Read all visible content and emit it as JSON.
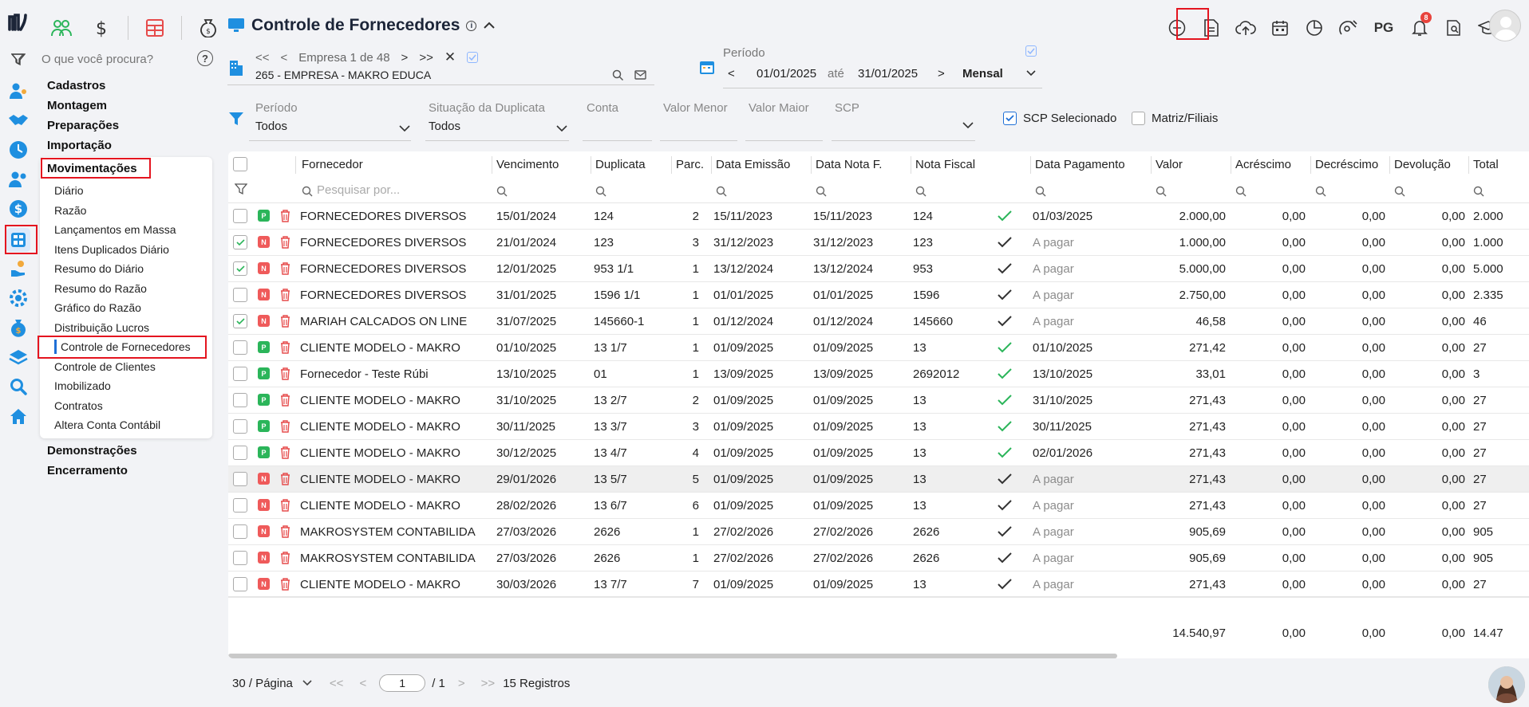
{
  "search": {
    "placeholder": "O que você procura?"
  },
  "menu": {
    "groups_top": [
      "Cadastros",
      "Montagem",
      "Preparações",
      "Importação",
      "Movimentações"
    ],
    "groups_bottom": [
      "Demonstrações",
      "Encerramento"
    ],
    "submenu": [
      "Diário",
      "Razão",
      "Lançamentos em Massa",
      "Itens Duplicados Diário",
      "Resumo do Diário",
      "Resumo do Razão",
      "Gráfico do Razão",
      "Distribuição Lucros",
      "Controle de Fornecedores",
      "Controle de Clientes",
      "Imobilizado",
      "Contratos",
      "Altera Conta Contábil"
    ],
    "active": "Controle de Fornecedores"
  },
  "header": {
    "title": "Controle de Fornecedores",
    "toolbar_text": "PG",
    "notifications_count": "8"
  },
  "empresa": {
    "nav_text": "Empresa 1 de 48",
    "name": "265 - EMPRESA - MAKRO EDUCA"
  },
  "periodo": {
    "label": "Período",
    "start": "01/01/2025",
    "sep": "até",
    "end": "31/01/2025",
    "mode": "Mensal"
  },
  "filters": {
    "periodo": {
      "label": "Período",
      "value": "Todos"
    },
    "situacao": {
      "label": "Situação da Duplicata",
      "value": "Todos"
    },
    "conta": {
      "label": "Conta",
      "value": ""
    },
    "valor_menor": {
      "label": "Valor Menor",
      "value": ""
    },
    "valor_maior": {
      "label": "Valor Maior",
      "value": ""
    },
    "scp": {
      "label": "SCP",
      "value": ""
    },
    "scp_selecionado": "SCP Selecionado",
    "matriz_filiais": "Matriz/Filiais"
  },
  "table": {
    "columns": [
      "Fornecedor",
      "Vencimento",
      "Duplicata",
      "Parc.",
      "Data Emissão",
      "Data Nota F.",
      "Nota Fiscal",
      "Data Pagamento",
      "Valor",
      "Acréscimo",
      "Decréscimo",
      "Devolução",
      "Total"
    ],
    "search_placeholder": "Pesquisar por...",
    "rows": [
      {
        "checked": false,
        "tag": "P",
        "fornecedor": "FORNECEDORES DIVERSOS",
        "vencimento": "15/01/2024",
        "duplicata": "124",
        "parc": "2",
        "emissao": "15/11/2023",
        "data_nf": "15/11/2023",
        "nf": "124",
        "paid": true,
        "pagamento": "01/03/2025",
        "valor": "2.000,00",
        "acrescimo": "0,00",
        "decrescimo": "0,00",
        "devolucao": "0,00",
        "total": "2.000"
      },
      {
        "checked": true,
        "tag": "N",
        "fornecedor": "FORNECEDORES DIVERSOS",
        "vencimento": "21/01/2024",
        "duplicata": "123",
        "parc": "3",
        "emissao": "31/12/2023",
        "data_nf": "31/12/2023",
        "nf": "123",
        "paid": false,
        "pagamento": "A pagar",
        "valor": "1.000,00",
        "acrescimo": "0,00",
        "decrescimo": "0,00",
        "devolucao": "0,00",
        "total": "1.000"
      },
      {
        "checked": true,
        "tag": "N",
        "fornecedor": "FORNECEDORES DIVERSOS",
        "vencimento": "12/01/2025",
        "duplicata": "953 1/1",
        "parc": "1",
        "emissao": "13/12/2024",
        "data_nf": "13/12/2024",
        "nf": "953",
        "paid": false,
        "pagamento": "A pagar",
        "valor": "5.000,00",
        "acrescimo": "0,00",
        "decrescimo": "0,00",
        "devolucao": "0,00",
        "total": "5.000"
      },
      {
        "checked": false,
        "tag": "N",
        "fornecedor": "FORNECEDORES DIVERSOS",
        "vencimento": "31/01/2025",
        "duplicata": "1596 1/1",
        "parc": "1",
        "emissao": "01/01/2025",
        "data_nf": "01/01/2025",
        "nf": "1596",
        "paid": false,
        "pagamento": "A pagar",
        "valor": "2.750,00",
        "acrescimo": "0,00",
        "decrescimo": "0,00",
        "devolucao": "0,00",
        "total": "2.335"
      },
      {
        "checked": true,
        "tag": "N",
        "fornecedor": "MARIAH CALCADOS ON LINE",
        "vencimento": "31/07/2025",
        "duplicata": "145660-1",
        "parc": "1",
        "emissao": "01/12/2024",
        "data_nf": "01/12/2024",
        "nf": "145660",
        "paid": false,
        "pagamento": "A pagar",
        "valor": "46,58",
        "acrescimo": "0,00",
        "decrescimo": "0,00",
        "devolucao": "0,00",
        "total": "46"
      },
      {
        "checked": false,
        "tag": "P",
        "fornecedor": "CLIENTE MODELO - MAKRO",
        "vencimento": "01/10/2025",
        "duplicata": "13 1/7",
        "parc": "1",
        "emissao": "01/09/2025",
        "data_nf": "01/09/2025",
        "nf": "13",
        "paid": true,
        "pagamento": "01/10/2025",
        "valor": "271,42",
        "acrescimo": "0,00",
        "decrescimo": "0,00",
        "devolucao": "0,00",
        "total": "27"
      },
      {
        "checked": false,
        "tag": "P",
        "fornecedor": "Fornecedor - Teste Rúbi",
        "vencimento": "13/10/2025",
        "duplicata": "01",
        "parc": "1",
        "emissao": "13/09/2025",
        "data_nf": "13/09/2025",
        "nf": "2692012",
        "paid": true,
        "pagamento": "13/10/2025",
        "valor": "33,01",
        "acrescimo": "0,00",
        "decrescimo": "0,00",
        "devolucao": "0,00",
        "total": "3"
      },
      {
        "checked": false,
        "tag": "P",
        "fornecedor": "CLIENTE MODELO - MAKRO",
        "vencimento": "31/10/2025",
        "duplicata": "13 2/7",
        "parc": "2",
        "emissao": "01/09/2025",
        "data_nf": "01/09/2025",
        "nf": "13",
        "paid": true,
        "pagamento": "31/10/2025",
        "valor": "271,43",
        "acrescimo": "0,00",
        "decrescimo": "0,00",
        "devolucao": "0,00",
        "total": "27"
      },
      {
        "checked": false,
        "tag": "P",
        "fornecedor": "CLIENTE MODELO - MAKRO",
        "vencimento": "30/11/2025",
        "duplicata": "13 3/7",
        "parc": "3",
        "emissao": "01/09/2025",
        "data_nf": "01/09/2025",
        "nf": "13",
        "paid": true,
        "pagamento": "30/11/2025",
        "valor": "271,43",
        "acrescimo": "0,00",
        "decrescimo": "0,00",
        "devolucao": "0,00",
        "total": "27"
      },
      {
        "checked": false,
        "tag": "P",
        "fornecedor": "CLIENTE MODELO - MAKRO",
        "vencimento": "30/12/2025",
        "duplicata": "13 4/7",
        "parc": "4",
        "emissao": "01/09/2025",
        "data_nf": "01/09/2025",
        "nf": "13",
        "paid": true,
        "pagamento": "02/01/2026",
        "valor": "271,43",
        "acrescimo": "0,00",
        "decrescimo": "0,00",
        "devolucao": "0,00",
        "total": "27"
      },
      {
        "checked": false,
        "tag": "N",
        "fornecedor": "CLIENTE MODELO - MAKRO",
        "vencimento": "29/01/2026",
        "duplicata": "13 5/7",
        "parc": "5",
        "emissao": "01/09/2025",
        "data_nf": "01/09/2025",
        "nf": "13",
        "paid": false,
        "pagamento": "A pagar",
        "valor": "271,43",
        "acrescimo": "0,00",
        "decrescimo": "0,00",
        "devolucao": "0,00",
        "total": "27"
      },
      {
        "checked": false,
        "tag": "N",
        "fornecedor": "CLIENTE MODELO - MAKRO",
        "vencimento": "28/02/2026",
        "duplicata": "13 6/7",
        "parc": "6",
        "emissao": "01/09/2025",
        "data_nf": "01/09/2025",
        "nf": "13",
        "paid": false,
        "pagamento": "A pagar",
        "valor": "271,43",
        "acrescimo": "0,00",
        "decrescimo": "0,00",
        "devolucao": "0,00",
        "total": "27"
      },
      {
        "checked": false,
        "tag": "N",
        "fornecedor": "MAKROSYSTEM CONTABILIDA",
        "vencimento": "27/03/2026",
        "duplicata": "2626",
        "parc": "1",
        "emissao": "27/02/2026",
        "data_nf": "27/02/2026",
        "nf": "2626",
        "paid": false,
        "pagamento": "A pagar",
        "valor": "905,69",
        "acrescimo": "0,00",
        "decrescimo": "0,00",
        "devolucao": "0,00",
        "total": "905"
      },
      {
        "checked": false,
        "tag": "N",
        "fornecedor": "MAKROSYSTEM CONTABILIDA",
        "vencimento": "27/03/2026",
        "duplicata": "2626",
        "parc": "1",
        "emissao": "27/02/2026",
        "data_nf": "27/02/2026",
        "nf": "2626",
        "paid": false,
        "pagamento": "A pagar",
        "valor": "905,69",
        "acrescimo": "0,00",
        "decrescimo": "0,00",
        "devolucao": "0,00",
        "total": "905"
      },
      {
        "checked": false,
        "tag": "N",
        "fornecedor": "CLIENTE MODELO - MAKRO",
        "vencimento": "30/03/2026",
        "duplicata": "13 7/7",
        "parc": "7",
        "emissao": "01/09/2025",
        "data_nf": "01/09/2025",
        "nf": "13",
        "paid": false,
        "pagamento": "A pagar",
        "valor": "271,43",
        "acrescimo": "0,00",
        "decrescimo": "0,00",
        "devolucao": "0,00",
        "total": "27"
      }
    ],
    "totals": {
      "valor": "14.540,97",
      "acrescimo": "0,00",
      "decrescimo": "0,00",
      "devolucao": "0,00",
      "total": "14.47"
    }
  },
  "footer": {
    "per_page": "30 / Página",
    "page": "1",
    "of_pages": "/ 1",
    "records": "15 Registros"
  },
  "colors": {
    "accent": "#1f6fd6",
    "paid_check": "#2bb55a",
    "tag_p": "#2bb55a",
    "tag_n": "#ef5a5a",
    "highlight_box": "#e4141f"
  }
}
